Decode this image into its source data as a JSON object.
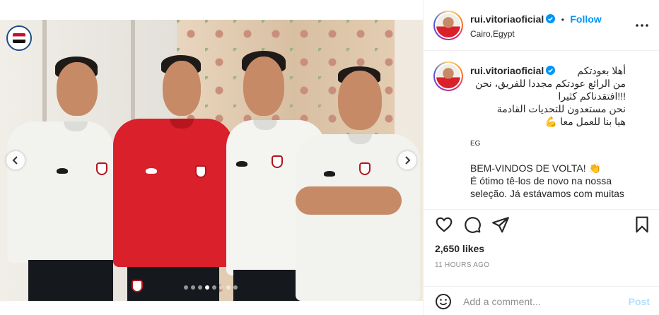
{
  "post": {
    "username": "rui.vitoriaoficial",
    "follow_label": "Follow",
    "separator": "•",
    "location": "Cairo,Egypt",
    "likes": "2,650 likes",
    "time_ago": "11 HOURS AGO"
  },
  "caption": {
    "username": "rui.vitoriaoficial",
    "arabic_lines": [
      "أهلا بعودتكم",
      "من الرائع عودتكم مجددا للفريق، نحن",
      "!!!افتقدناكم كثيرا",
      "نحن مستعدون للتحديات القادمة",
      "هيا بنا للعمل معا 💪"
    ],
    "country_tag": "EG",
    "latin_lines": [
      "BEM-VINDOS DE VOLTA! 👏",
      "É ótimo tê-los de novo na nossa",
      "seleção. Já estávamos com muitas"
    ]
  },
  "carousel": {
    "slide_count": 8,
    "active_index": 3
  },
  "comment": {
    "placeholder": "Add a comment...",
    "post_label": "Post"
  },
  "colors": {
    "accent": "#0095f6",
    "post_disabled": "#b2dffc",
    "muted": "#8e8e8e",
    "verified": "#0095f6"
  },
  "icons": {
    "more": "more-horizontal-icon",
    "like": "heart-icon",
    "comment": "comment-bubble-icon",
    "share": "paper-plane-icon",
    "save": "bookmark-icon",
    "emoji": "smiley-icon",
    "prev": "chevron-left-icon",
    "next": "chevron-right-icon",
    "verified": "verified-badge-icon",
    "logo": "efa-crest-logo"
  }
}
